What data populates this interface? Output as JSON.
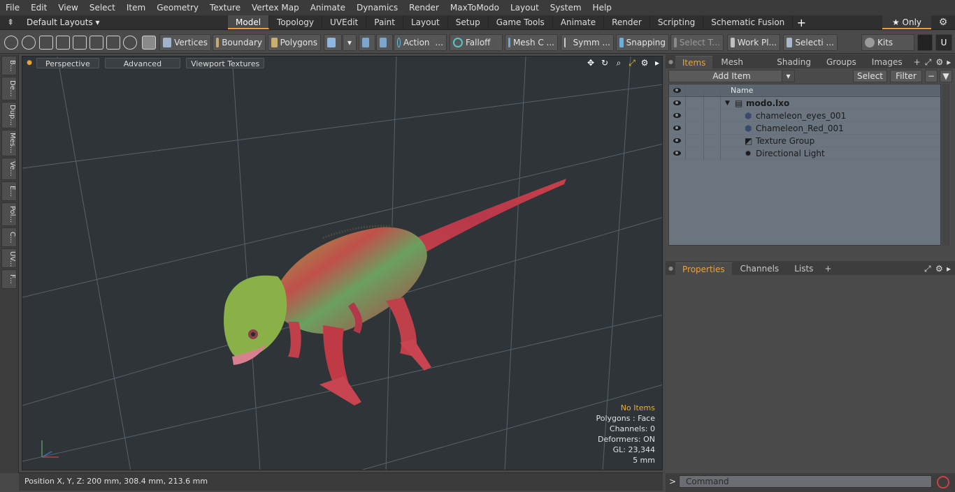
{
  "menu": [
    "File",
    "Edit",
    "View",
    "Select",
    "Item",
    "Geometry",
    "Texture",
    "Vertex Map",
    "Animate",
    "Dynamics",
    "Render",
    "MaxToModo",
    "Layout",
    "System",
    "Help"
  ],
  "layouts_label": "Default Layouts ▾",
  "layout_tabs": [
    "Model",
    "Topology",
    "UVEdit",
    "Paint",
    "Layout",
    "Setup",
    "Game Tools",
    "Animate",
    "Render",
    "Scripting",
    "Schematic Fusion"
  ],
  "active_tab": "Model",
  "only_label": "★ Only",
  "toolbar": {
    "vertices": "Vertices",
    "boundary": "Boundary",
    "polygons": "Polygons",
    "action": "Action",
    "falloff": "Falloff",
    "mesh_c": "Mesh C ...",
    "symm": "Symm ...",
    "snapping": "Snapping",
    "select_t": "Select T...",
    "work_pl": "Work Pl...",
    "selecti": "Selecti ...",
    "kits": "Kits"
  },
  "left_tabs": [
    "B...",
    "De...",
    "Dup...",
    "Mes...",
    "Ve...",
    "E...",
    "Pol...",
    "C...",
    "UV...",
    "F..."
  ],
  "viewport": {
    "perspective": "Perspective",
    "advanced": "Advanced",
    "viewport_textures": "Viewport Textures"
  },
  "hud": {
    "no_items": "No Items",
    "polygons": "Polygons : Face",
    "channels": "Channels: 0",
    "deformers": "Deformers: ON",
    "gl": "GL: 23,344",
    "scale": "5 mm"
  },
  "status_position": "Position X, Y, Z:   200 mm, 308.4 mm, 213.6 mm",
  "items_panel": {
    "tabs": [
      "Items",
      "Mesh Ops",
      "Shading",
      "Groups",
      "Images"
    ],
    "add_item": "Add Item",
    "select": "Select",
    "filter": "Filter",
    "name_header": "Name",
    "rows": [
      {
        "label": "modo.lxo"
      },
      {
        "label": "chameleon_eyes_001"
      },
      {
        "label": "Chameleon_Red_001"
      },
      {
        "label": "Texture Group"
      },
      {
        "label": "Directional Light"
      }
    ]
  },
  "props_panel": {
    "tabs": [
      "Properties",
      "Channels",
      "Lists"
    ]
  },
  "command_placeholder": "Command",
  "colors": {
    "accent": "#f0a030",
    "viewport_bg": "#2e3438",
    "list_bg": "#6b7580"
  }
}
